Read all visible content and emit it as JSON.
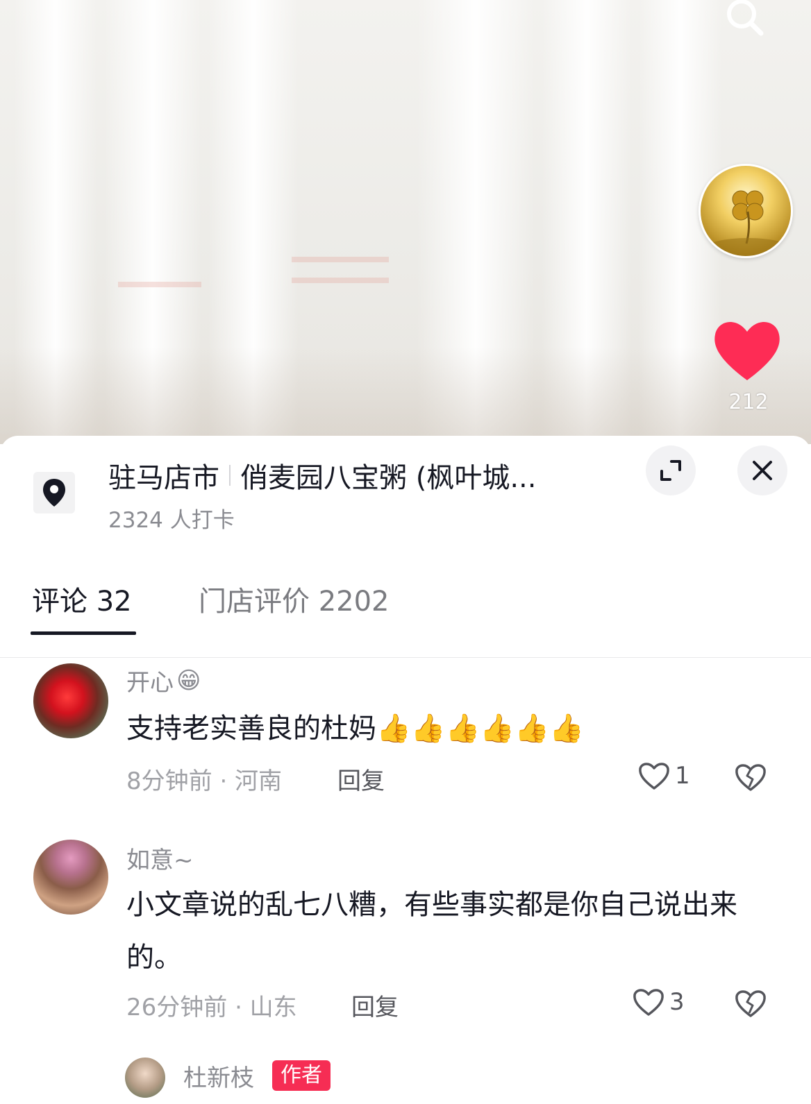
{
  "video": {
    "like_count": "212"
  },
  "location": {
    "city": "驻马店市",
    "name": "俏麦园八宝粥 (枫叶城...",
    "checkins": "2324 人打卡"
  },
  "tabs": [
    {
      "label": "评论 32"
    },
    {
      "label": "门店评价 2202"
    }
  ],
  "comments": [
    {
      "username": "开心",
      "emoji": "😁",
      "text": "支持老实善良的杜妈",
      "text_emoji": "👍👍👍👍👍👍",
      "meta": "8分钟前 · 河南",
      "reply_label": "回复",
      "likes": "1"
    },
    {
      "username": "如意~",
      "text": "小文章说的乱七八糟，有些事实都是你自己说出来的。",
      "meta": "26分钟前 · 山东",
      "reply_label": "回复",
      "likes": "3"
    }
  ],
  "author_reply": {
    "username": "杜新枝",
    "badge": "作者"
  },
  "colors": {
    "like_red": "#fe2c55",
    "badge_red": "#f62d54",
    "text_primary": "#161823",
    "text_secondary": "#8a8b91"
  },
  "icons": [
    "search-icon",
    "heart-icon",
    "location-pin-icon",
    "expand-icon",
    "close-icon",
    "heart-outline-icon",
    "broken-heart-icon"
  ]
}
